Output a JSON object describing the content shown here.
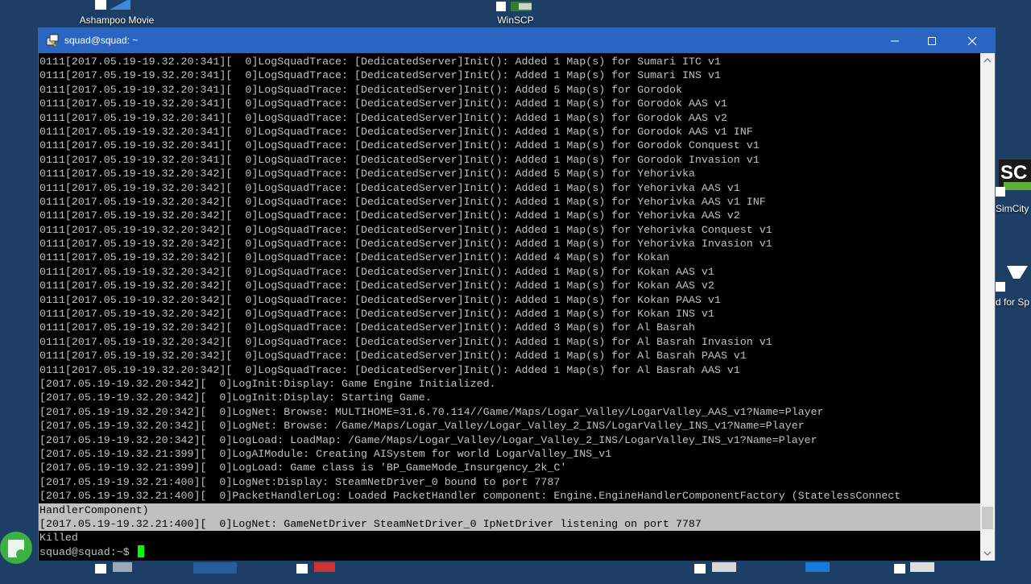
{
  "desktop": {
    "icons": [
      {
        "label": "Ashampoo Movie"
      },
      {
        "label": "WinSCP"
      },
      {
        "label": "SimCity"
      },
      {
        "label": "d for Sp"
      }
    ]
  },
  "window": {
    "title": "squad@squad: ~",
    "controls": {
      "minimize": "—",
      "maximize": "☐",
      "close": "✕"
    }
  },
  "terminal": {
    "lines": [
      "0111[2017.05.19-19.32.20:341][  0]LogSquadTrace: [DedicatedServer]Init(): Added 1 Map(s) for Sumari ITC v1",
      "0111[2017.05.19-19.32.20:341][  0]LogSquadTrace: [DedicatedServer]Init(): Added 1 Map(s) for Sumari INS v1",
      "0111[2017.05.19-19.32.20:341][  0]LogSquadTrace: [DedicatedServer]Init(): Added 5 Map(s) for Gorodok",
      "0111[2017.05.19-19.32.20:341][  0]LogSquadTrace: [DedicatedServer]Init(): Added 1 Map(s) for Gorodok AAS v1",
      "0111[2017.05.19-19.32.20:341][  0]LogSquadTrace: [DedicatedServer]Init(): Added 1 Map(s) for Gorodok AAS v2",
      "0111[2017.05.19-19.32.20:341][  0]LogSquadTrace: [DedicatedServer]Init(): Added 1 Map(s) for Gorodok AAS v1 INF",
      "0111[2017.05.19-19.32.20:341][  0]LogSquadTrace: [DedicatedServer]Init(): Added 1 Map(s) for Gorodok Conquest v1",
      "0111[2017.05.19-19.32.20:341][  0]LogSquadTrace: [DedicatedServer]Init(): Added 1 Map(s) for Gorodok Invasion v1",
      "0111[2017.05.19-19.32.20:342][  0]LogSquadTrace: [DedicatedServer]Init(): Added 5 Map(s) for Yehorivka",
      "0111[2017.05.19-19.32.20:342][  0]LogSquadTrace: [DedicatedServer]Init(): Added 1 Map(s) for Yehorivka AAS v1",
      "0111[2017.05.19-19.32.20:342][  0]LogSquadTrace: [DedicatedServer]Init(): Added 1 Map(s) for Yehorivka AAS v1 INF",
      "0111[2017.05.19-19.32.20:342][  0]LogSquadTrace: [DedicatedServer]Init(): Added 1 Map(s) for Yehorivka AAS v2",
      "0111[2017.05.19-19.32.20:342][  0]LogSquadTrace: [DedicatedServer]Init(): Added 1 Map(s) for Yehorivka Conquest v1",
      "0111[2017.05.19-19.32.20:342][  0]LogSquadTrace: [DedicatedServer]Init(): Added 1 Map(s) for Yehorivka Invasion v1",
      "0111[2017.05.19-19.32.20:342][  0]LogSquadTrace: [DedicatedServer]Init(): Added 4 Map(s) for Kokan",
      "0111[2017.05.19-19.32.20:342][  0]LogSquadTrace: [DedicatedServer]Init(): Added 1 Map(s) for Kokan AAS v1",
      "0111[2017.05.19-19.32.20:342][  0]LogSquadTrace: [DedicatedServer]Init(): Added 1 Map(s) for Kokan AAS v2",
      "0111[2017.05.19-19.32.20:342][  0]LogSquadTrace: [DedicatedServer]Init(): Added 1 Map(s) for Kokan PAAS v1",
      "0111[2017.05.19-19.32.20:342][  0]LogSquadTrace: [DedicatedServer]Init(): Added 1 Map(s) for Kokan INS v1",
      "0111[2017.05.19-19.32.20:342][  0]LogSquadTrace: [DedicatedServer]Init(): Added 3 Map(s) for Al Basrah",
      "0111[2017.05.19-19.32.20:342][  0]LogSquadTrace: [DedicatedServer]Init(): Added 1 Map(s) for Al Basrah Invasion v1",
      "0111[2017.05.19-19.32.20:342][  0]LogSquadTrace: [DedicatedServer]Init(): Added 1 Map(s) for Al Basrah PAAS v1",
      "0111[2017.05.19-19.32.20:342][  0]LogSquadTrace: [DedicatedServer]Init(): Added 1 Map(s) for Al Basrah AAS v1",
      "[2017.05.19-19.32.20:342][  0]LogInit:Display: Game Engine Initialized.",
      "[2017.05.19-19.32.20:342][  0]LogInit:Display: Starting Game.",
      "[2017.05.19-19.32.20:342][  0]LogNet: Browse: MULTIHOME=31.6.70.114//Game/Maps/Logar_Valley/LogarValley_AAS_v1?Name=Player",
      "[2017.05.19-19.32.20:342][  0]LogNet: Browse: /Game/Maps/Logar_Valley/Logar_Valley_2_INS/LogarValley_INS_v1?Name=Player",
      "[2017.05.19-19.32.20:342][  0]LogLoad: LoadMap: /Game/Maps/Logar_Valley/Logar_Valley_2_INS/LogarValley_INS_v1?Name=Player",
      "[2017.05.19-19.32.21:399][  0]LogAIModule: Creating AISystem for world LogarValley_INS_v1",
      "[2017.05.19-19.32.21:399][  0]LogLoad: Game class is 'BP_GameMode_Insurgency_2k_C'",
      "[2017.05.19-19.32.21:400][  0]LogNet:Display: SteamNetDriver_0 bound to port 7787",
      "[2017.05.19-19.32.21:400][  0]PacketHandlerLog: Loaded PacketHandler component: Engine.EngineHandlerComponentFactory (StatelessConnect"
    ],
    "selected_lines": [
      "HandlerComponent)",
      "[2017.05.19-19.32.21:400][  0]LogNet: GameNetDriver SteamNetDriver_0 IpNetDriver listening on port 7787"
    ],
    "tail_lines": [
      "Killed"
    ],
    "prompt": "squad@squad:~$ "
  }
}
